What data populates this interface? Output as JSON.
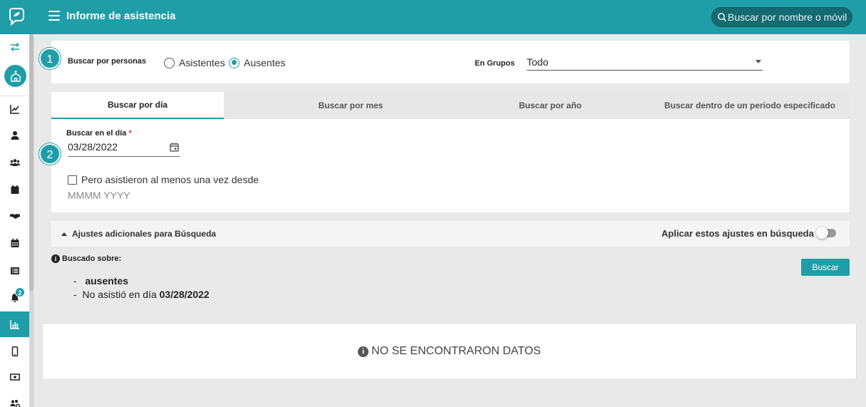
{
  "header": {
    "title": "Informe de asistencia",
    "search_placeholder": "Buscar por nombre o móvil"
  },
  "sidebar": {
    "notification_count": "2",
    "items": [
      "swap-icon",
      "church-icon",
      "chart-line-icon",
      "person-icon",
      "group-icon",
      "calendar-icon",
      "handshake-icon",
      "calendar-grid-icon",
      "list-icon",
      "bell-icon",
      "bar-chart-icon",
      "mobile-icon",
      "money-icon",
      "people-gear-icon"
    ],
    "active_item": "bar-chart-icon"
  },
  "filter": {
    "step1": "1",
    "search_by_people_label": "Buscar por personas",
    "options": [
      "Asistentes",
      "Ausentes"
    ],
    "selected": "Ausentes",
    "groups_label": "En Grupos",
    "groups_value": "Todo"
  },
  "tabs": [
    {
      "label": "Buscar por día",
      "active": true
    },
    {
      "label": "Buscar por mes",
      "active": false
    },
    {
      "label": "Buscar por año",
      "active": false
    },
    {
      "label": "Buscar dentro de un periodo especificado",
      "active": false
    }
  ],
  "day_search": {
    "step2": "2",
    "label": "Buscar en el día",
    "required_mark": "*",
    "date_value": "03/28/2022",
    "checkbox_label": "Pero asistieron al menos una vez desde",
    "checkbox_checked": false,
    "month_placeholder": "MMMM YYYY"
  },
  "advanced": {
    "title": "Ajustes adicionales para Búsqueda",
    "apply_label": "Aplicar estos ajustes en búsqueda",
    "apply_enabled": false
  },
  "summary": {
    "heading": "Buscado sobre:",
    "dash": "-",
    "criteria_1": "ausentes",
    "criteria_2_prefix": "No asistió en día ",
    "criteria_2_date": "03/28/2022"
  },
  "search_button": "Buscar",
  "results": {
    "empty_message": "NO SE ENCONTRARON DATOS"
  },
  "colors": {
    "accent": "#1f9ea7"
  }
}
